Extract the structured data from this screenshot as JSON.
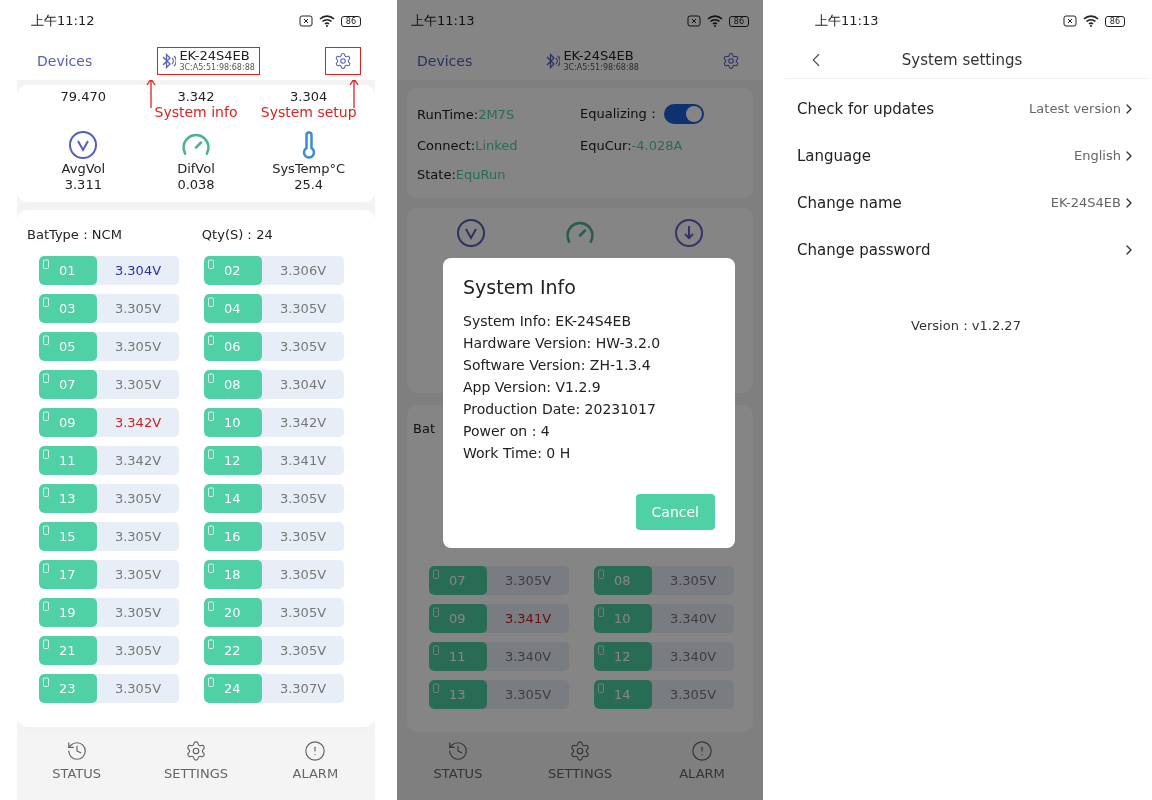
{
  "cell_screen": {
    "status_bar": {
      "time": "上午11:12",
      "battery": "86"
    },
    "header": {
      "back_label": "Devices",
      "device_name": "EK-24S4EB",
      "device_mac": "3C:A5:51:98:68:88"
    },
    "annotations": [
      {
        "kind": "device",
        "label": "System info"
      },
      {
        "kind": "settings",
        "label": "System setup"
      }
    ],
    "top_values": [
      "79.470",
      "3.342",
      "3.304"
    ],
    "stats": [
      {
        "kind": "voltage",
        "label": "AvgVol",
        "value": "3.311"
      },
      {
        "kind": "gauge",
        "label": "DifVol",
        "value": "0.038"
      },
      {
        "kind": "temperature",
        "label": "SysTemp°C",
        "value": "25.4"
      }
    ],
    "battery_type": "BatType：NCM",
    "quantity": "Qty(S)：24",
    "cells": [
      {
        "index": "01",
        "voltage": "3.304V",
        "kind": "min"
      },
      {
        "index": "02",
        "voltage": "3.306V",
        "kind": "normal"
      },
      {
        "index": "03",
        "voltage": "3.305V",
        "kind": "normal"
      },
      {
        "index": "04",
        "voltage": "3.305V",
        "kind": "normal"
      },
      {
        "index": "05",
        "voltage": "3.305V",
        "kind": "normal"
      },
      {
        "index": "06",
        "voltage": "3.305V",
        "kind": "normal"
      },
      {
        "index": "07",
        "voltage": "3.305V",
        "kind": "normal"
      },
      {
        "index": "08",
        "voltage": "3.304V",
        "kind": "normal"
      },
      {
        "index": "09",
        "voltage": "3.342V",
        "kind": "max"
      },
      {
        "index": "10",
        "voltage": "3.342V",
        "kind": "normal"
      },
      {
        "index": "11",
        "voltage": "3.342V",
        "kind": "normal"
      },
      {
        "index": "12",
        "voltage": "3.341V",
        "kind": "normal"
      },
      {
        "index": "13",
        "voltage": "3.305V",
        "kind": "normal"
      },
      {
        "index": "14",
        "voltage": "3.305V",
        "kind": "normal"
      },
      {
        "index": "15",
        "voltage": "3.305V",
        "kind": "normal"
      },
      {
        "index": "16",
        "voltage": "3.305V",
        "kind": "normal"
      },
      {
        "index": "17",
        "voltage": "3.305V",
        "kind": "normal"
      },
      {
        "index": "18",
        "voltage": "3.305V",
        "kind": "normal"
      },
      {
        "index": "19",
        "voltage": "3.305V",
        "kind": "normal"
      },
      {
        "index": "20",
        "voltage": "3.305V",
        "kind": "normal"
      },
      {
        "index": "21",
        "voltage": "3.305V",
        "kind": "normal"
      },
      {
        "index": "22",
        "voltage": "3.305V",
        "kind": "normal"
      },
      {
        "index": "23",
        "voltage": "3.305V",
        "kind": "normal"
      },
      {
        "index": "24",
        "voltage": "3.307V",
        "kind": "normal"
      }
    ],
    "nav": [
      {
        "kind": "history",
        "label": "STATUS"
      },
      {
        "kind": "settings",
        "label": "SETTINGS"
      },
      {
        "kind": "alarm",
        "label": "ALARM"
      }
    ]
  },
  "info_screen": {
    "status_bar": {
      "time": "上午11:13",
      "battery": "86"
    },
    "header": {
      "back_label": "Devices",
      "device_name": "EK-24S4EB",
      "device_mac": "3C:A5:51:98:68:88"
    },
    "status_items": [
      {
        "label": "RunTime:",
        "value": "2M7S"
      },
      {
        "label": "Connect:",
        "value": "Linked"
      },
      {
        "label": "State:",
        "value": "EquRun"
      }
    ],
    "equalizing": {
      "label": "Equalizing：",
      "on": true
    },
    "equ_current": {
      "label": "EquCur:",
      "value": "-4.028A"
    },
    "stat_icons": [
      {
        "kind": "voltage"
      },
      {
        "kind": "gauge"
      },
      {
        "kind": "charge"
      }
    ],
    "battery_label": "Bat",
    "cells": [
      {
        "index": "07",
        "voltage": "3.305V",
        "kind": "normal"
      },
      {
        "index": "08",
        "voltage": "3.305V",
        "kind": "normal"
      },
      {
        "index": "09",
        "voltage": "3.341V",
        "kind": "max"
      },
      {
        "index": "10",
        "voltage": "3.340V",
        "kind": "normal"
      },
      {
        "index": "11",
        "voltage": "3.340V",
        "kind": "normal"
      },
      {
        "index": "12",
        "voltage": "3.340V",
        "kind": "normal"
      },
      {
        "index": "13",
        "voltage": "3.305V",
        "kind": "normal"
      },
      {
        "index": "14",
        "voltage": "3.305V",
        "kind": "normal"
      }
    ],
    "nav": [
      {
        "kind": "history",
        "label": "STATUS"
      },
      {
        "kind": "settings",
        "label": "SETTINGS"
      },
      {
        "kind": "alarm",
        "label": "ALARM"
      }
    ],
    "dialog": {
      "title": "System Info",
      "lines": [
        "System Info: EK-24S4EB",
        "Hardware Version: HW-3.2.0",
        "Software Version: ZH-1.3.4",
        "App Version: V1.2.9",
        "Production Date: 20231017",
        "Power on : 4",
        "Work Time: 0 H"
      ],
      "cancel_label": "Cancel"
    }
  },
  "settings_screen": {
    "status_bar": {
      "time": "上午11:13",
      "battery": "86"
    },
    "title": "System settings",
    "items": [
      {
        "label": "Check for updates",
        "value": "Latest version"
      },
      {
        "label": "Language",
        "value": "English"
      },
      {
        "label": "Change name",
        "value": "EK-24S4EB"
      },
      {
        "label": "Change password"
      }
    ],
    "version": "Version：v1.2.27"
  }
}
